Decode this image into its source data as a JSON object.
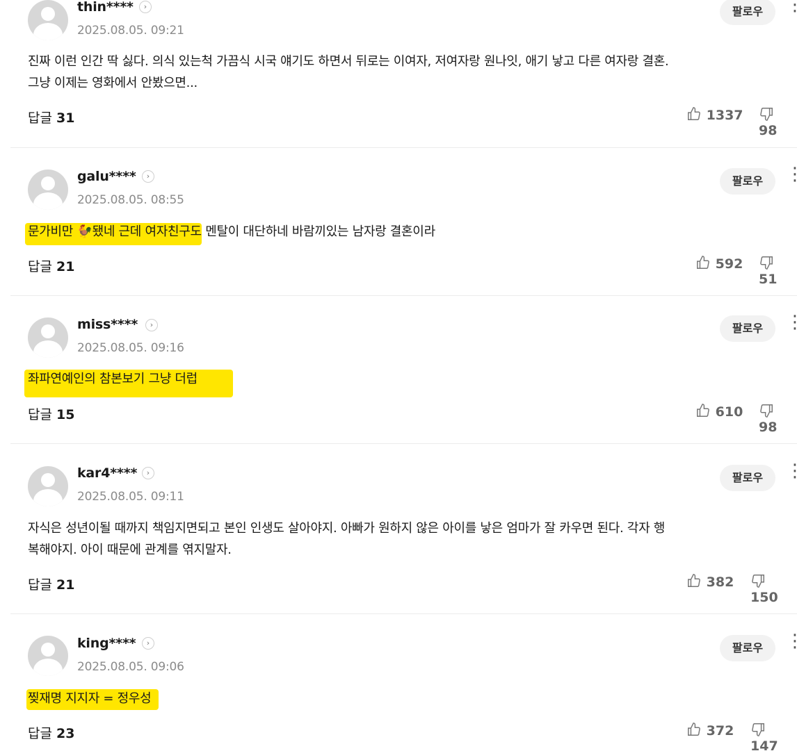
{
  "follow_label": "팔로우",
  "reply_label": "답글",
  "comments": [
    {
      "nickname": "thin****",
      "date": "2025.08.05. 09:21",
      "text_line1": "진짜 이런 인간 딱 싫다. 의식 있는척 가끔식 시국 얘기도 하면서 뒤로는 이여자, 저여자랑 원나잇, 애기 낳고 다른 여자랑 결혼.",
      "text_line2": "그냥 이제는 영화에서 안봤으면...",
      "reply_count": "31",
      "likes": "1337",
      "dislikes": "98"
    },
    {
      "nickname": "galu****",
      "date": "2025.08.05. 08:55",
      "text_pre": "문가비만 ",
      "text_emoji": "🐓",
      "text_post": "됐네 근데 여자친구도 멘탈이 대단하네 바람끼있는 남자랑 결혼이라",
      "reply_count": "21",
      "likes": "592",
      "dislikes": "51"
    },
    {
      "nickname": "miss****",
      "date": "2025.08.05. 09:16",
      "text_line1": "좌파연예인의 참본보기 그냥 더럽",
      "reply_count": "15",
      "likes": "610",
      "dislikes": "98"
    },
    {
      "nickname": "kar4****",
      "date": "2025.08.05. 09:11",
      "text_line1": "자식은 성년이될 때까지 책임지면되고 본인 인생도 살아야지. 아빠가 원하지 않은 아이를 낳은 엄마가 잘 카우면 된다. 각자 행",
      "text_line2": "복해야지. 아이 때문에 관계를 엮지말자.",
      "reply_count": "21",
      "likes": "382",
      "dislikes": "150"
    },
    {
      "nickname": "king****",
      "date": "2025.08.05. 09:06",
      "text_line1": "찢재명 지지자 = 정우성",
      "reply_count": "23",
      "likes": "372",
      "dislikes": "147"
    }
  ],
  "colors": {
    "highlight": "#ffe600",
    "date": "#8b8b8b",
    "follow_bg": "#f2f2f2"
  },
  "icons": [
    "chevron-right-icon",
    "more-vertical-icon",
    "thumbs-up-icon",
    "thumbs-down-icon",
    "avatar-icon"
  ]
}
